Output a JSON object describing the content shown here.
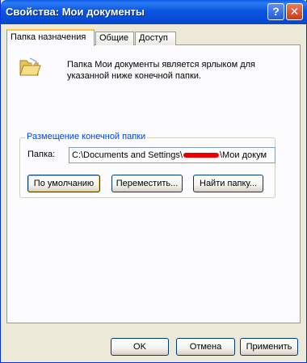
{
  "window": {
    "title": "Свойства: Мои документы",
    "help_glyph": "?",
    "close_glyph": "✕"
  },
  "tabs": [
    {
      "label": "Папка назначения",
      "active": true
    },
    {
      "label": "Общие",
      "active": false
    },
    {
      "label": "Доступ",
      "active": false
    }
  ],
  "target": {
    "description": "Папка Мои документы является ярлыком для указанной ниже конечной папки.",
    "group_title": "Размещение конечной папки",
    "folder_label": "Папка:",
    "path_prefix": "C:\\Documents and Settings\\",
    "path_suffix": "\\Мои докум",
    "buttons": {
      "restore_default": "По умолчанию",
      "move": "Переместить...",
      "find_target": "Найти папку..."
    }
  },
  "footer": {
    "ok": "OK",
    "cancel": "Отмена",
    "apply": "Применить"
  },
  "colors": {
    "title_bar": "#0A55E0",
    "group_title": "#0046D5",
    "redaction": "#F00000"
  }
}
